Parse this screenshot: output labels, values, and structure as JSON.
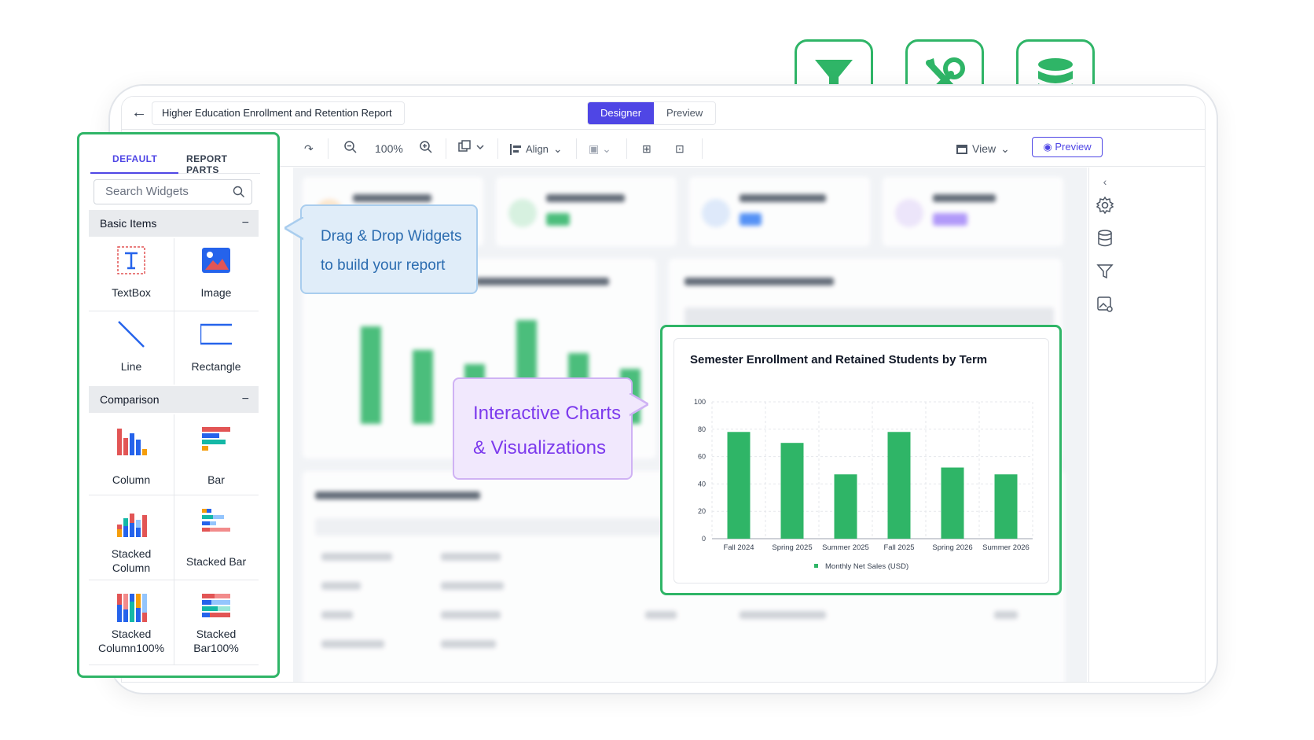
{
  "header": {
    "report_title": "Higher Education Enrollment and Retention Report",
    "designer_label": "Designer",
    "preview_tab_label": "Preview"
  },
  "toolbar": {
    "zoom": "100%",
    "align_label": "Align",
    "view_label": "View",
    "preview_button": "Preview"
  },
  "widget_panel": {
    "tabs": [
      "DEFAULT",
      "REPORT PARTS"
    ],
    "search_placeholder": "Search Widgets",
    "sections": [
      {
        "title": "Basic Items",
        "items": [
          "TextBox",
          "Image",
          "Line",
          "Rectangle"
        ]
      },
      {
        "title": "Comparison",
        "items": [
          "Column",
          "Bar",
          "Stacked\nColumn",
          "Stacked Bar",
          "Stacked\nColumn100%",
          "Stacked\nBar100%"
        ]
      }
    ]
  },
  "callouts": {
    "drag_drop_line1": "Drag & Drop Widgets",
    "drag_drop_line2": "to build your report",
    "charts_line1": "Interactive Charts",
    "charts_line2": "& Visualizations"
  },
  "top_icons": [
    "filter-icon",
    "tools-icon",
    "database-icon"
  ],
  "colors": {
    "accent": "#2fb567",
    "brand": "#4f46e5"
  },
  "chart_data": {
    "type": "bar",
    "title": "Semester Enrollment and Retained Students by Term",
    "categories": [
      "Fall 2024",
      "Spring 2025",
      "Summer 2025",
      "Fall 2025",
      "Spring 2026",
      "Summer 2026"
    ],
    "series": [
      {
        "name": "Monthly Net Sales (USD)",
        "values": [
          78,
          70,
          47,
          78,
          52,
          47
        ],
        "color": "#2fb567"
      }
    ],
    "yticks": [
      0,
      20,
      40,
      60,
      80,
      100
    ],
    "ylim": [
      0,
      100
    ],
    "grid": true,
    "legend": "bottom"
  }
}
